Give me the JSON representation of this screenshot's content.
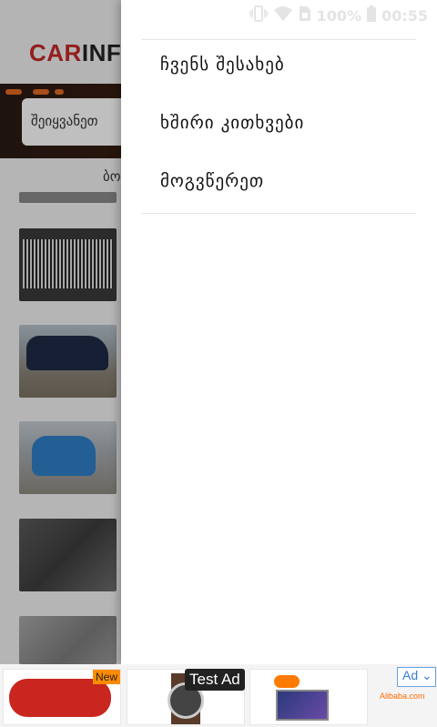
{
  "status_bar": {
    "battery": "100%",
    "time": "00:55"
  },
  "app": {
    "logo_part1": "CAR",
    "logo_part2": "INF",
    "search_placeholder": "შეიყვანეთ",
    "section_label": "ბოლ"
  },
  "drawer": {
    "menu": [
      {
        "label": "ჩვენს შესახებ"
      },
      {
        "label": "ხშირი კითხვები"
      },
      {
        "label": "მოგვწერეთ"
      }
    ]
  },
  "ad": {
    "new_badge": "New",
    "test_ad": "Test Ad",
    "ad_label": "Ad",
    "advertiser": "Alibaba.com"
  }
}
